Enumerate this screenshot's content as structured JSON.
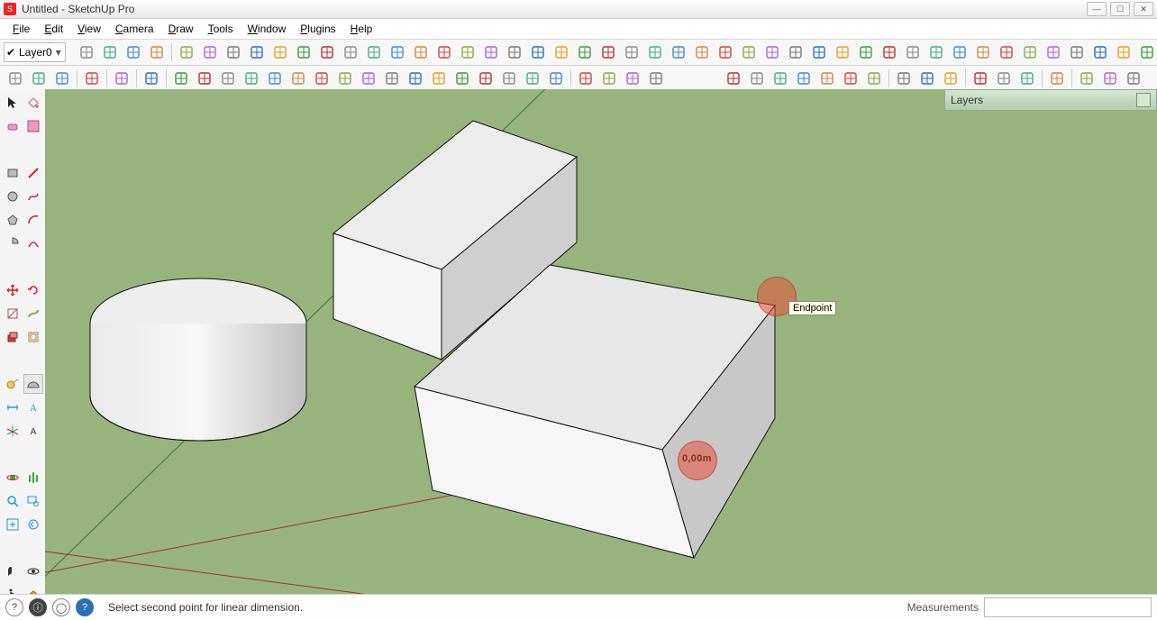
{
  "title": "Untitled - SketchUp Pro",
  "menus": [
    "File",
    "Edit",
    "View",
    "Camera",
    "Draw",
    "Tools",
    "Window",
    "Plugins",
    "Help"
  ],
  "layer": {
    "visible_check": "✔",
    "name": "Layer0"
  },
  "layers_panel": {
    "title": "Layers"
  },
  "status": {
    "hint": "Select second point for linear dimension.",
    "meas_label": "Measurements"
  },
  "tooltip": "Endpoint",
  "dim_text": "0,00m",
  "toolbar_top_icons": [
    "make-component",
    "faces",
    "check",
    "start-page",
    "sep",
    "cube1",
    "cube2",
    "cube3",
    "cube4",
    "cube5",
    "cube6",
    "cube7",
    "cube8",
    "cube9",
    "cube10",
    "push1",
    "push2",
    "sweep1",
    "sweep2",
    "sweep3",
    "diag1",
    "diag2",
    "diag3",
    "line1",
    "line2",
    "line3",
    "line4",
    "blank",
    "rect1",
    "rect2",
    "rect3",
    "rect4",
    "hatch1",
    "hatch2",
    "hatch3",
    "hatch4",
    "hatch5",
    "hatch6",
    "hatch7",
    "lines-a",
    "lines-b",
    "lines-c",
    "lines-d",
    "misc1",
    "misc2",
    "misc3",
    "misc4",
    "misc5",
    "sep",
    "skin",
    "xy",
    "rub",
    "play",
    "rec",
    "wave",
    "sep",
    "tree",
    "grass",
    "bush",
    "shrub"
  ],
  "toolbar_mid_icons": [
    "box-plus",
    "cylinder",
    "star",
    "sep",
    "red-tool",
    "sep",
    "vert-bars",
    "sep",
    "undo",
    "sep",
    "m1",
    "m2",
    "m3",
    "m4",
    "m5",
    "m6",
    "m7",
    "m8",
    "m9",
    "m10",
    "m11",
    "m12",
    "m13",
    "m14",
    "m15",
    "m16",
    "m17",
    "sep",
    "sun",
    "ray",
    "line",
    "linev",
    "spacer",
    "spacer",
    "spacer",
    "hatch1",
    "hatch2",
    "hatch3",
    "hatch4",
    "hatch5",
    "hatch6",
    "hatch7",
    "sep",
    "book",
    "layers",
    "paint",
    "sep",
    "folder",
    "photo",
    "person",
    "sep",
    "globe",
    "sep",
    "cube",
    "cube2",
    "cube3"
  ],
  "left_tools": [
    [
      "select",
      "paint-bucket"
    ],
    [
      "eraser",
      "material"
    ],
    [
      "",
      ""
    ],
    [
      "rectangle",
      "line"
    ],
    [
      "circle",
      "freehand"
    ],
    [
      "polygon",
      "arc"
    ],
    [
      "pie",
      "curve"
    ],
    [
      "",
      ""
    ],
    [
      "move",
      "rotate"
    ],
    [
      "scale",
      "follow-me"
    ],
    [
      "push-pull",
      "offset"
    ],
    [
      "",
      ""
    ],
    [
      "tape",
      "protractor"
    ],
    [
      "dimension",
      "text"
    ],
    [
      "axes",
      "3dtext"
    ],
    [
      "",
      ""
    ],
    [
      "orbit",
      "pan"
    ],
    [
      "zoom",
      "zoom-window"
    ],
    [
      "zoom-extents",
      "previous"
    ],
    [
      "",
      ""
    ],
    [
      "position-camera",
      "look-around"
    ],
    [
      "walk",
      "section"
    ]
  ]
}
